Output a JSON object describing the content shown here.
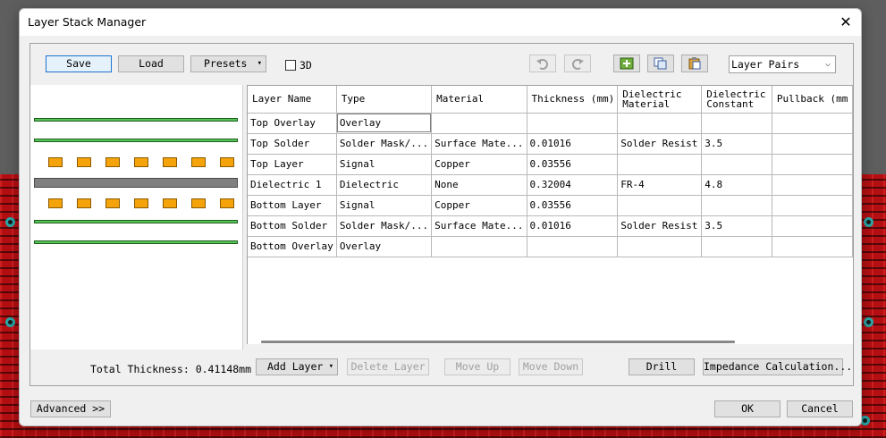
{
  "window": {
    "title": "Layer Stack Manager"
  },
  "toolbar": {
    "save_label": "Save",
    "load_label": "Load",
    "presets_label": "Presets",
    "threed_label": "3D",
    "pairs_value": "Layer Pairs"
  },
  "icons": {
    "undo": "undo-icon",
    "redo": "redo-icon",
    "add": "add-layer-icon",
    "copy": "copy-icon",
    "paste": "paste-icon",
    "close": "close-icon"
  },
  "table": {
    "columns": [
      "Layer Name",
      "Type",
      "Material",
      "Thickness (mm)",
      "Dielectric Material",
      "Dielectric Constant",
      "Pullback (mm"
    ],
    "rows": [
      [
        "Top Overlay",
        "Overlay",
        "",
        "",
        "",
        "",
        ""
      ],
      [
        "Top Solder",
        "Solder Mask/...",
        "Surface Mate...",
        "0.01016",
        "Solder Resist",
        "3.5",
        ""
      ],
      [
        "Top Layer",
        "Signal",
        "Copper",
        "0.03556",
        "",
        "",
        ""
      ],
      [
        "Dielectric 1",
        "Dielectric",
        "None",
        "0.32004",
        "FR-4",
        "4.8",
        ""
      ],
      [
        "Bottom Layer",
        "Signal",
        "Copper",
        "0.03556",
        "",
        "",
        ""
      ],
      [
        "Bottom Solder",
        "Solder Mask/...",
        "Surface Mate...",
        "0.01016",
        "Solder Resist",
        "3.5",
        ""
      ],
      [
        "Bottom Overlay",
        "Overlay",
        "",
        "",
        "",
        "",
        ""
      ]
    ]
  },
  "footer": {
    "total_thickness": "Total Thickness: 0.41148mm",
    "add_layer_label": "Add Layer",
    "delete_layer_label": "Delete Layer",
    "move_up_label": "Move Up",
    "move_down_label": "Move Down",
    "drill_label": "Drill",
    "impedance_label": "Impedance Calculation...",
    "advanced_label": "Advanced >>",
    "ok_label": "OK",
    "cancel_label": "Cancel"
  },
  "colors": {
    "overlay": "#59c259",
    "copper": "#f5a30b",
    "dielectric": "#808080",
    "pcb": "#b40f12"
  }
}
